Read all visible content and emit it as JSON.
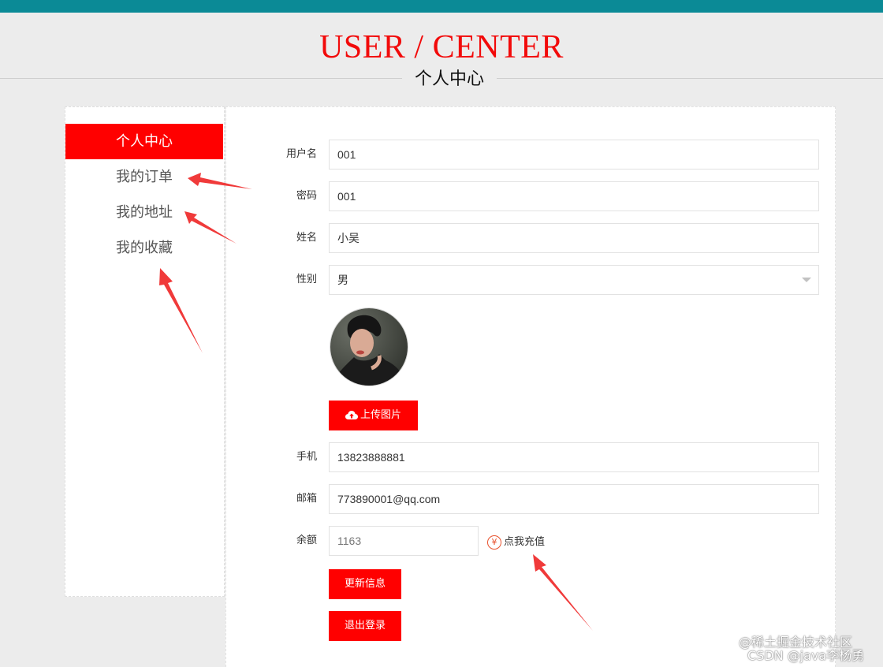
{
  "header": {
    "title": "USER / CENTER",
    "subtitle": "个人中心"
  },
  "sidebar": {
    "items": [
      {
        "label": "个人中心",
        "active": true
      },
      {
        "label": "我的订单",
        "active": false
      },
      {
        "label": "我的地址",
        "active": false
      },
      {
        "label": "我的收藏",
        "active": false
      }
    ]
  },
  "form": {
    "username": {
      "label": "用户名",
      "value": "001"
    },
    "password": {
      "label": "密码",
      "value": "001"
    },
    "name": {
      "label": "姓名",
      "value": "小吴"
    },
    "gender": {
      "label": "性别",
      "value": "男"
    },
    "upload_label": "上传图片",
    "phone": {
      "label": "手机",
      "value": "13823888881"
    },
    "email": {
      "label": "邮箱",
      "value": "773890001@qq.com"
    },
    "balance": {
      "label": "余额",
      "value": "1163"
    },
    "recharge_icon": "¥",
    "recharge_label": "点我充值",
    "update_label": "更新信息",
    "logout_label": "退出登录"
  },
  "watermark": {
    "line1": "@稀土掘金技术社区",
    "line2": "CSDN @java李杨勇"
  },
  "icons": {
    "upload": "cloud-upload-icon",
    "recharge": "yen-icon",
    "select": "caret-down-icon"
  },
  "colors": {
    "topbar": "#0b8a96",
    "accent": "#ff0000",
    "background": "#ececec"
  }
}
